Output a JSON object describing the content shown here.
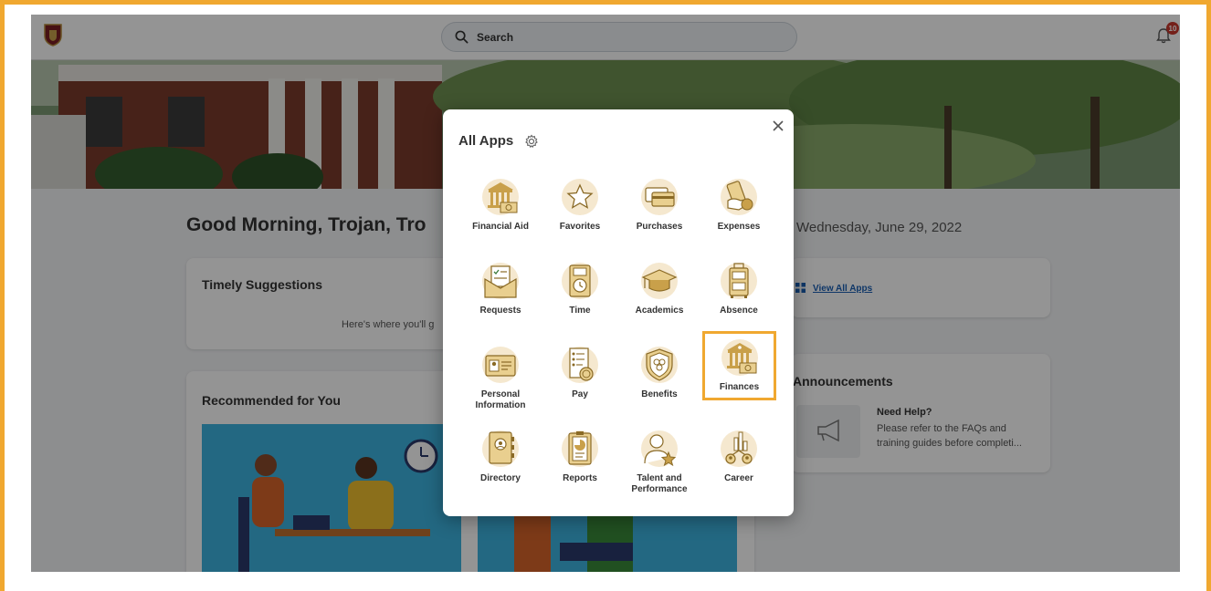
{
  "header": {
    "search_placeholder": "Search",
    "notification_count": "10"
  },
  "home": {
    "greeting": "Good Morning, Trojan, Tro",
    "date": "Wednesday, June 29, 2022",
    "timely_suggestions": {
      "title": "Timely Suggestions",
      "text": "Here's where you'll g"
    },
    "view_all_apps": "View All Apps",
    "recommended": {
      "title": "Recommended for You"
    },
    "announcements": {
      "title": "Announcements",
      "item_title": "Need Help?",
      "item_line1": "Please refer to the FAQs and",
      "item_line2": "training guides before completi..."
    }
  },
  "modal": {
    "title": "All Apps",
    "apps": [
      {
        "label": "Financial Aid",
        "icon": "bank-cash-icon"
      },
      {
        "label": "Favorites",
        "icon": "star-icon"
      },
      {
        "label": "Purchases",
        "icon": "credit-card-icon"
      },
      {
        "label": "Expenses",
        "icon": "money-hand-icon"
      },
      {
        "label": "Requests",
        "icon": "envelope-checklist-icon"
      },
      {
        "label": "Time",
        "icon": "clock-icon"
      },
      {
        "label": "Academics",
        "icon": "graduation-cap-icon"
      },
      {
        "label": "Absence",
        "icon": "suitcase-icon"
      },
      {
        "label": "Personal Information",
        "icon": "id-card-icon"
      },
      {
        "label": "Pay",
        "icon": "receipt-coin-icon"
      },
      {
        "label": "Benefits",
        "icon": "shield-icon"
      },
      {
        "label": "Finances",
        "icon": "bank-cash-icon"
      },
      {
        "label": "Directory",
        "icon": "address-book-icon"
      },
      {
        "label": "Reports",
        "icon": "report-clipboard-icon"
      },
      {
        "label": "Talent and Performance",
        "icon": "person-star-icon"
      },
      {
        "label": "Career",
        "icon": "career-ladder-icon"
      }
    ]
  },
  "colors": {
    "accent": "#f0a830",
    "icon_gold": "#c9a04a",
    "icon_bg": "#f5e8cf",
    "badge": "#c8372d"
  }
}
